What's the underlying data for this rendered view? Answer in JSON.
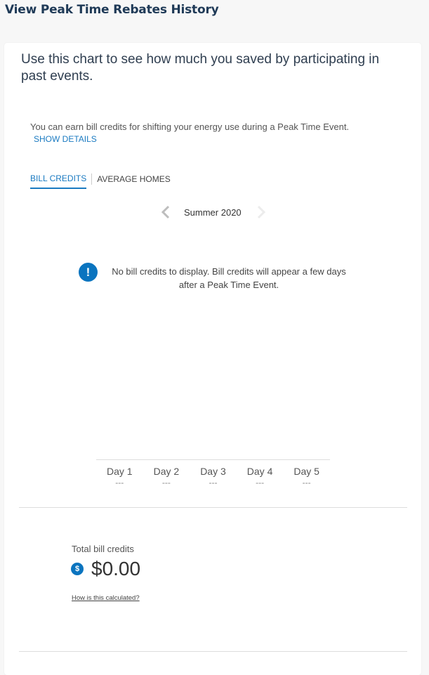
{
  "header": {
    "title": "View Peak Time Rebates History"
  },
  "card": {
    "intro": "Use this chart to see how much you saved by participating in past events.",
    "description": "You can earn bill credits for shifting your energy use during a Peak Time Event.",
    "show_details_label": "SHOW DETAILS",
    "tabs": [
      {
        "label": "BILL CREDITS",
        "active": true
      },
      {
        "label": "AVERAGE HOMES",
        "active": false
      }
    ],
    "season_nav": {
      "current": "Summer 2020",
      "prev_icon": "chevron-left-icon",
      "next_icon": "chevron-right-icon",
      "prev_enabled": true,
      "next_enabled": false
    },
    "notice": {
      "icon": "exclamation-icon",
      "icon_glyph": "!",
      "text": "No bill credits to display. Bill credits will appear a few days after a Peak Time Event."
    },
    "days": [
      {
        "label": "Day 1",
        "value": "---"
      },
      {
        "label": "Day 2",
        "value": "---"
      },
      {
        "label": "Day 3",
        "value": "---"
      },
      {
        "label": "Day 4",
        "value": "---"
      },
      {
        "label": "Day 5",
        "value": "---"
      }
    ],
    "total": {
      "label": "Total bill credits",
      "icon": "dollar-icon",
      "icon_glyph": "$",
      "value": "$0.00",
      "how_link": "How is this calculated?"
    }
  },
  "colors": {
    "accent": "#1a7ac1",
    "icon_blue": "#0a74bf",
    "title": "#1f3a57",
    "background": "#f7f7f7"
  }
}
